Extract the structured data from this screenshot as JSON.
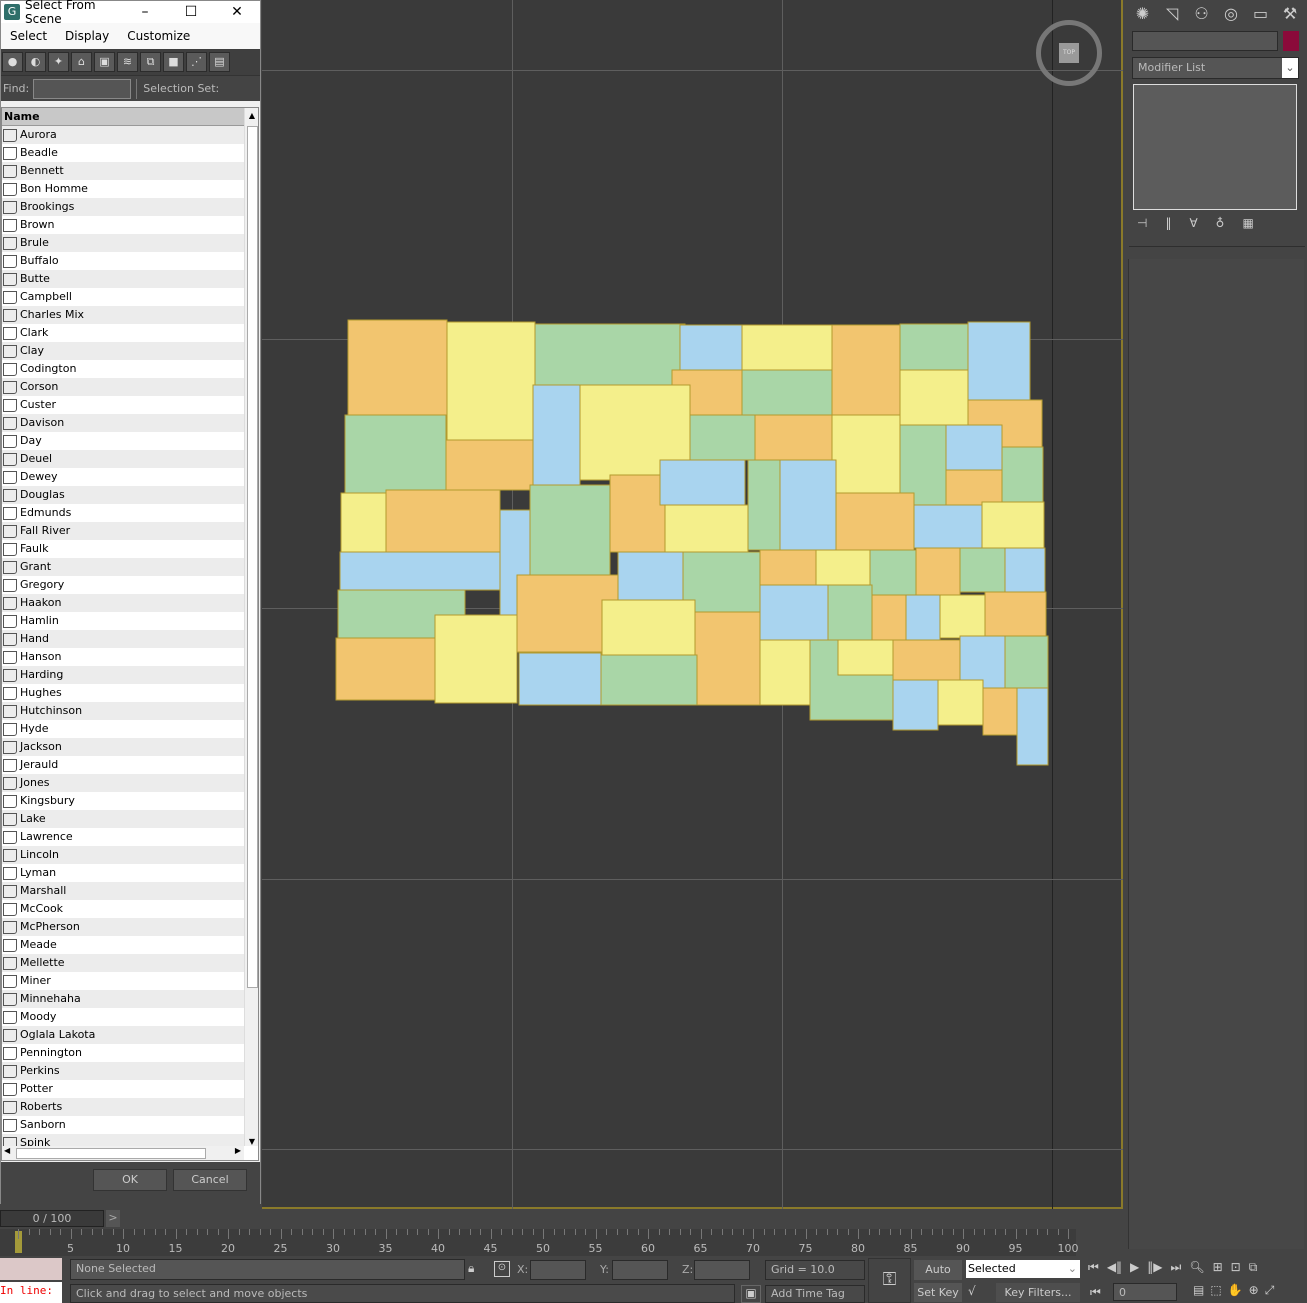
{
  "dialog": {
    "title": "Select From Scene",
    "menu": [
      "Select",
      "Display",
      "Customize"
    ],
    "toolbar_icons": [
      "geometry-icon",
      "shapes-icon",
      "lights-icon",
      "cameras-icon",
      "helpers-icon",
      "spacewarps-icon",
      "groups-icon",
      "xrefs-icon",
      "bones-icon",
      "containers-icon"
    ],
    "find_label": "Find:",
    "find_value": "",
    "selection_set_label": "Selection Set:",
    "column_header": "Name",
    "items": [
      "Aurora",
      "Beadle",
      "Bennett",
      "Bon Homme",
      "Brookings",
      "Brown",
      "Brule",
      "Buffalo",
      "Butte",
      "Campbell",
      "Charles Mix",
      "Clark",
      "Clay",
      "Codington",
      "Corson",
      "Custer",
      "Davison",
      "Day",
      "Deuel",
      "Dewey",
      "Douglas",
      "Edmunds",
      "Fall River",
      "Faulk",
      "Grant",
      "Gregory",
      "Haakon",
      "Hamlin",
      "Hand",
      "Hanson",
      "Harding",
      "Hughes",
      "Hutchinson",
      "Hyde",
      "Jackson",
      "Jerauld",
      "Jones",
      "Kingsbury",
      "Lake",
      "Lawrence",
      "Lincoln",
      "Lyman",
      "Marshall",
      "McCook",
      "McPherson",
      "Meade",
      "Mellette",
      "Miner",
      "Minnehaha",
      "Moody",
      "Oglala Lakota",
      "Pennington",
      "Perkins",
      "Potter",
      "Roberts",
      "Sanborn",
      "Spink"
    ],
    "ok": "OK",
    "cancel": "Cancel"
  },
  "viewport": {
    "viewcube_label": "TOP",
    "map_colors": {
      "yellow": "#f4ef8b",
      "orange": "#f2c56f",
      "green": "#a9d6a7",
      "blue": "#a9d4ef",
      "border": "#b39a2e"
    }
  },
  "command_panel": {
    "tabs": [
      "create-icon",
      "modify-icon",
      "hierarchy-icon",
      "motion-icon",
      "display-icon",
      "utilities-icon"
    ],
    "object_color": "#8b0a3a",
    "modifier_list": "Modifier List"
  },
  "timeline": {
    "frame": "0 / 100",
    "ticks": [
      "0",
      "5",
      "10",
      "15",
      "20",
      "25",
      "30",
      "35",
      "40",
      "45",
      "50",
      "55",
      "60",
      "65",
      "70",
      "75",
      "80",
      "85",
      "90",
      "95",
      "100"
    ]
  },
  "status": {
    "maxscript": "In line:",
    "selection": "None Selected",
    "prompt": "Click and drag to select and move objects",
    "x_label": "X:",
    "y_label": "Y:",
    "z_label": "Z:",
    "grid": "Grid = 10.0",
    "add_time_tag": "Add Time Tag",
    "auto_key": "Auto Key",
    "set_key": "Set Key",
    "key_mode": "Selected",
    "key_filters": "Key Filters...",
    "current_frame": "0"
  }
}
